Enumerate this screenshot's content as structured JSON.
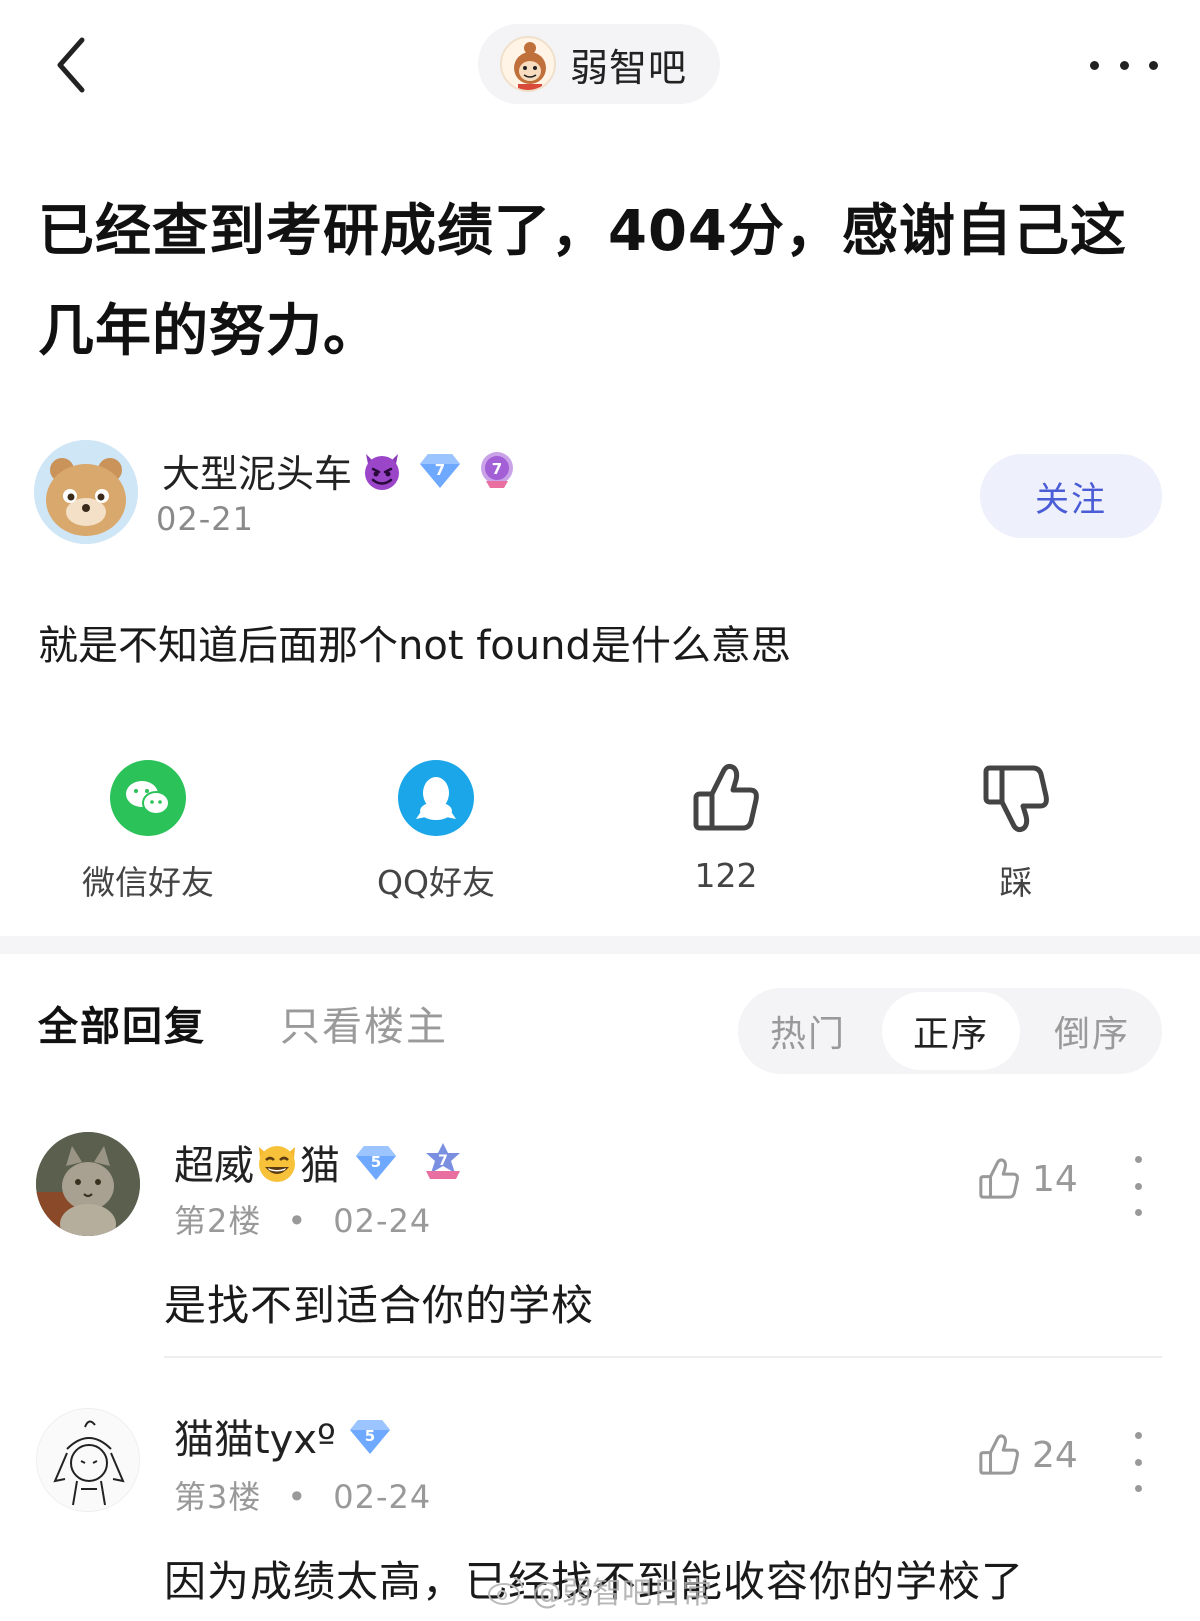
{
  "header": {
    "forum_name": "弱智吧"
  },
  "post": {
    "title": "已经查到考研成绩了，404分，感谢自己这几年的努力。",
    "author_name": "大型泥头车",
    "author_level": "7",
    "author_medal_level": "7",
    "date": "02-21",
    "follow_label": "关注",
    "body": "就是不知道后面那个not found是什么意思"
  },
  "actions": {
    "wechat_label": "微信好友",
    "qq_label": "QQ好友",
    "like_count": "122",
    "dislike_label": "踩"
  },
  "tabs": {
    "all_label": "全部回复",
    "op_only_label": "只看楼主",
    "sort_hot": "热门",
    "sort_asc": "正序",
    "sort_desc": "倒序"
  },
  "replies": [
    {
      "name_before": "超威",
      "name_after": "猫",
      "level": "5",
      "medal_level": "7",
      "floor": "第2楼",
      "date": "02-24",
      "likes": "14",
      "text": "是找不到适合你的学校"
    },
    {
      "name": "猫猫tyxº",
      "level": "5",
      "floor": "第3楼",
      "date": "02-24",
      "likes": "24",
      "text": "因为成绩太高，已经找不到能收容你的学校了"
    }
  ],
  "watermark": "@弱智吧日常",
  "colors": {
    "accent": "#4a5cd6",
    "follow_bg": "#eef0fb",
    "wechat": "#2bc25a",
    "qq": "#1aa6e8",
    "muted_text": "#999999"
  }
}
